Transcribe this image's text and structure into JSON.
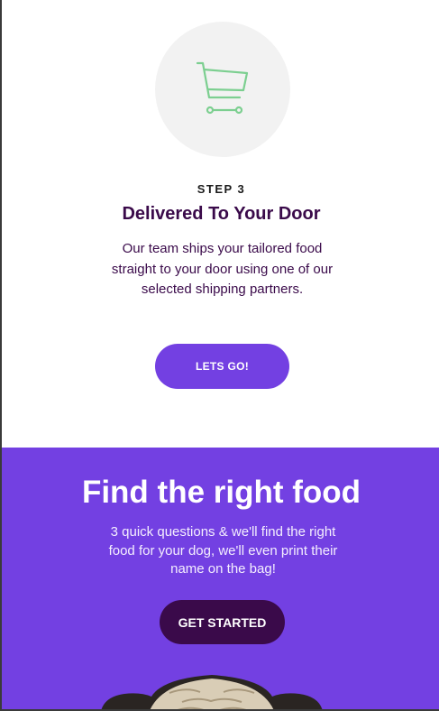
{
  "step": {
    "icon": "shopping-cart-icon",
    "icon_color": "#7ccf90",
    "label": "STEP 3",
    "title": "Delivered To Your Door",
    "description": "Our team ships your tailored food straight to your door using one of our selected shipping partners.",
    "button_label": "LETS GO!"
  },
  "cta": {
    "title": "Find the right food",
    "description": "3 quick questions & we'll find the right food for your dog, we'll even print their name on the bag!",
    "button_label": "GET STARTED",
    "image": "pug-dog-photo"
  },
  "colors": {
    "accent": "#7340e2",
    "dark_purple": "#3a0a4a",
    "icon_bg": "#f2f2f2"
  }
}
